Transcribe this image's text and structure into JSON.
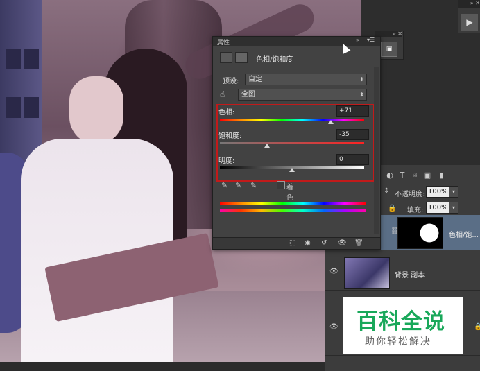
{
  "properties_panel": {
    "title": "属性",
    "collapse_glyph": "»",
    "menu_glyph": "▾☰",
    "close_glyph": "✕",
    "adjustment_name": "色相/饱和度",
    "preset_label": "预设:",
    "preset_value": "自定",
    "channel_value": "全图",
    "hue_label": "色相:",
    "hue_value": "+71",
    "saturation_label": "饱和度:",
    "saturation_value": "-35",
    "lightness_label": "明度:",
    "lightness_value": "0",
    "colorize_label": "着色"
  },
  "layers_panel": {
    "opacity_label": "不透明度:",
    "opacity_value": "100%",
    "fill_label": "填充:",
    "fill_value": "100%",
    "layers": [
      {
        "name": "色相/饱...",
        "selected": true
      },
      {
        "name": "背景 副本",
        "selected": false
      },
      {
        "name": "",
        "selected": false
      }
    ]
  },
  "mini_panel": {
    "icon_text": "▣"
  },
  "watermark": {
    "title": "百科全说",
    "subtitle": "助你轻松解决"
  },
  "colors": {
    "highlight_red": "#c21a1a",
    "layer_selected": "#5a6e86",
    "watermark_green": "#19a85a"
  }
}
